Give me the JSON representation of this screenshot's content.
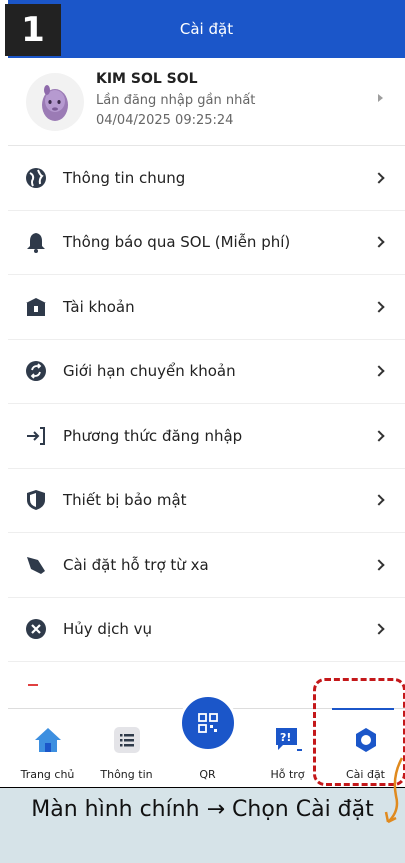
{
  "step": "1",
  "header": {
    "title": "Cài đặt"
  },
  "profile": {
    "name": "KIM SOL SOL",
    "last_login_label": "Lần đăng nhập gần nhất",
    "last_login_time": "04/04/2025 09:25:24"
  },
  "menu": {
    "items": [
      {
        "label": "Thông tin chung",
        "icon": "globe-icon"
      },
      {
        "label": "Thông báo qua SOL (Miễn phí)",
        "icon": "bell-icon"
      },
      {
        "label": "Tài khoản",
        "icon": "bank-icon"
      },
      {
        "label": "Giới hạn chuyển khoản",
        "icon": "transfer-limit-icon"
      },
      {
        "label": "Phương thức đăng nhập",
        "icon": "login-icon"
      },
      {
        "label": "Thiết bị bảo mật",
        "icon": "shield-icon"
      },
      {
        "label": "Cài đặt hỗ trợ từ xa",
        "icon": "remote-support-icon"
      },
      {
        "label": "Hủy dịch vụ",
        "icon": "cancel-icon"
      }
    ]
  },
  "tabbar": {
    "home": "Trang chủ",
    "info": "Thông tin",
    "qr": "QR",
    "support": "Hỗ trợ",
    "settings": "Cài đặt"
  },
  "caption": "Màn hình chính → Chọn Cài đặt",
  "colors": {
    "brand": "#1b56c9",
    "highlight": "#c4181a",
    "caption_bg": "#d6e3e8"
  }
}
